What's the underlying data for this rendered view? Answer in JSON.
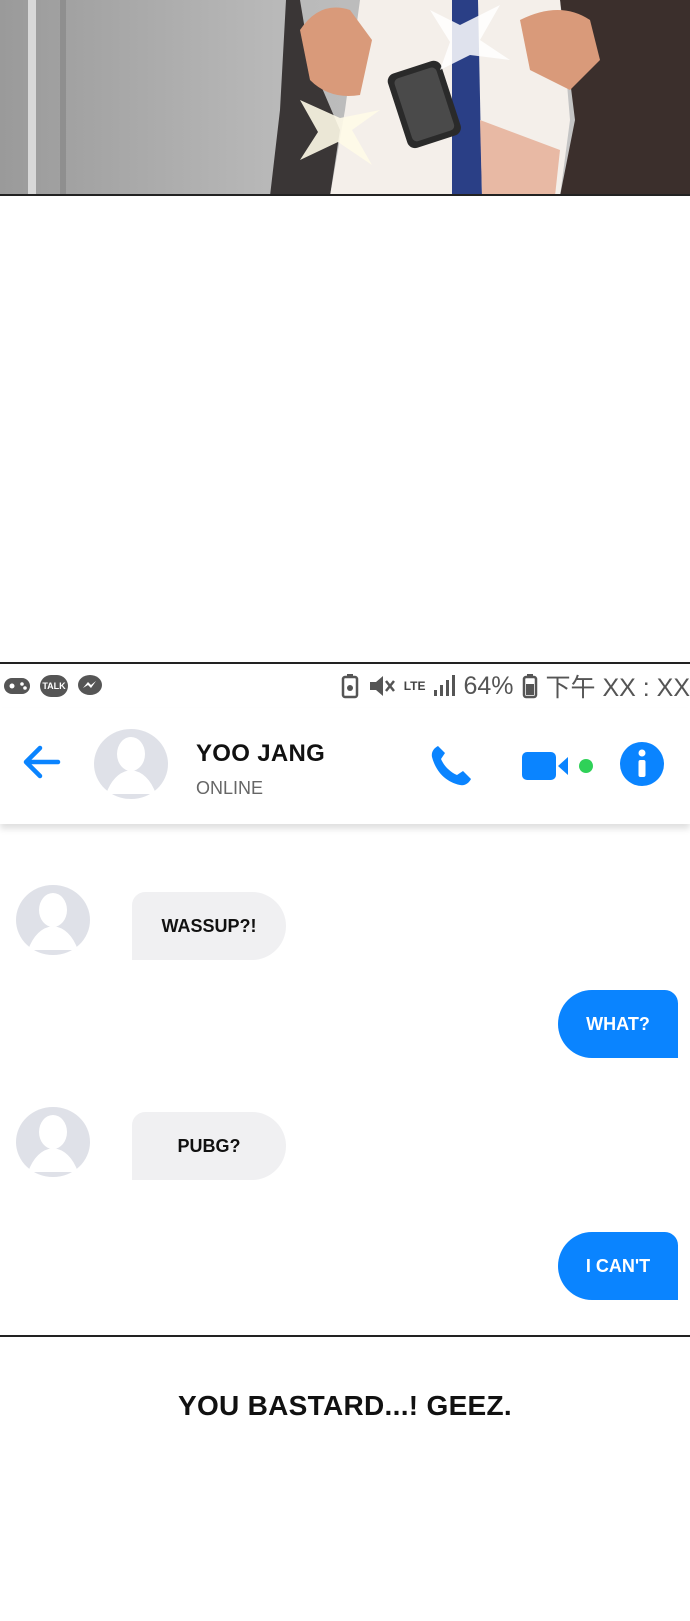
{
  "status_bar": {
    "left_icons": [
      "game-icon",
      "talk-icon",
      "messenger-icon"
    ],
    "talk_badge": "TALK",
    "network": "LTE",
    "battery_percent": "64%",
    "clock": "下午 XX : XX"
  },
  "chat_header": {
    "contact_name": "YOO JANG",
    "contact_status": "ONLINE",
    "online_dot_color": "#2fd158",
    "accent_color": "#0a84ff"
  },
  "messages": [
    {
      "direction": "incoming",
      "text": "WASSUP?!"
    },
    {
      "direction": "outgoing",
      "text": "WHAT?"
    },
    {
      "direction": "incoming",
      "text": "PUBG?"
    },
    {
      "direction": "outgoing",
      "text": "I CAN'T"
    }
  ],
  "caption": "YOU BASTARD...! GEEZ."
}
